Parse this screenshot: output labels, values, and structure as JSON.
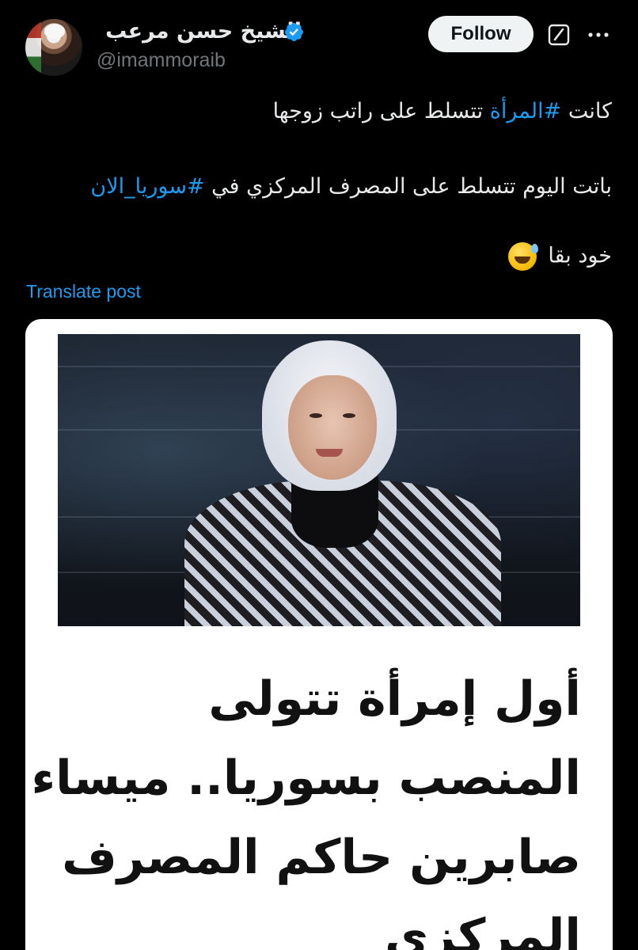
{
  "author": {
    "name": "الشيخ حسن مرعب",
    "handle": "@imammoraib",
    "verified": true,
    "avatar": "avatar-photo"
  },
  "actions": {
    "follow_label": "Follow",
    "grok_icon": "grok-icon",
    "more_icon": "more-dots-icon"
  },
  "post": {
    "line1_prefix": "كانت ",
    "line1_hashtag": "#المرأة",
    "line1_suffix": " تتسلط على راتب زوجها",
    "line2_prefix": "باتت اليوم تتسلط على المصرف المركزي في ",
    "line2_hashtag": "#سوريا_الان",
    "line3_text": "خود بقا",
    "line3_emoji": "grinning-sweat-emoji",
    "translate_label": "Translate post"
  },
  "media": {
    "photo": "woman-in-hijab-portrait",
    "headline_lines": [
      "أول إمرأة تتولى",
      "المنصب بسوريا.. ميساء",
      "صابرين حاكم المصرف",
      "المركزي"
    ]
  },
  "colors": {
    "background": "#000000",
    "text": "#e7e9ea",
    "secondary": "#71767b",
    "link": "#1d9bf0",
    "verified": "#1d9bf0",
    "button_bg": "#eff3f4"
  }
}
